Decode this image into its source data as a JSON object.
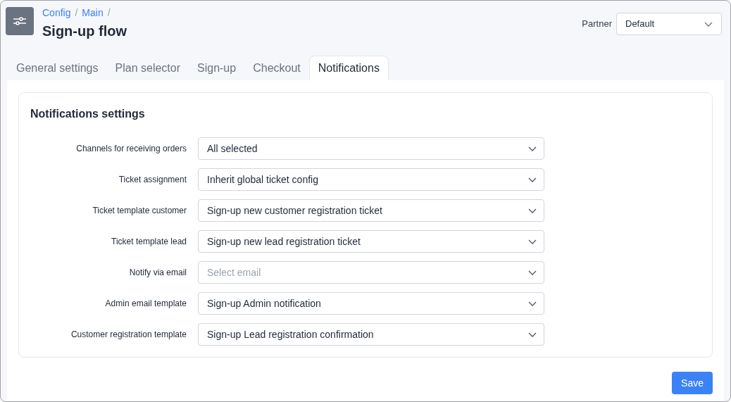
{
  "breadcrumb": [
    {
      "label": "Config",
      "separator": "/"
    },
    {
      "label": "Main",
      "separator": "/"
    }
  ],
  "title": "Sign-up flow",
  "partner": {
    "label": "Partner",
    "value": "Default"
  },
  "tabs": [
    {
      "label": "General settings",
      "selected": false
    },
    {
      "label": "Plan selector",
      "selected": false
    },
    {
      "label": "Sign-up",
      "selected": false
    },
    {
      "label": "Checkout",
      "selected": false
    },
    {
      "label": "Notifications",
      "selected": true
    }
  ],
  "section": {
    "title": "Notifications settings",
    "fields": [
      {
        "label": "Channels for receiving orders",
        "value": "All selected"
      },
      {
        "label": "Ticket assignment",
        "value": "Inherit global ticket config"
      },
      {
        "label": "Ticket template customer",
        "value": "Sign-up new customer registration ticket"
      },
      {
        "label": "Ticket template lead",
        "value": "Sign-up new lead registration ticket"
      },
      {
        "label": "Notify via email",
        "placeholder": "Select email"
      },
      {
        "label": "Admin email template",
        "value": "Sign-up Admin notification"
      },
      {
        "label": "Customer registration template",
        "value": "Sign-up Lead registration confirmation"
      }
    ]
  },
  "save_button": "Save"
}
